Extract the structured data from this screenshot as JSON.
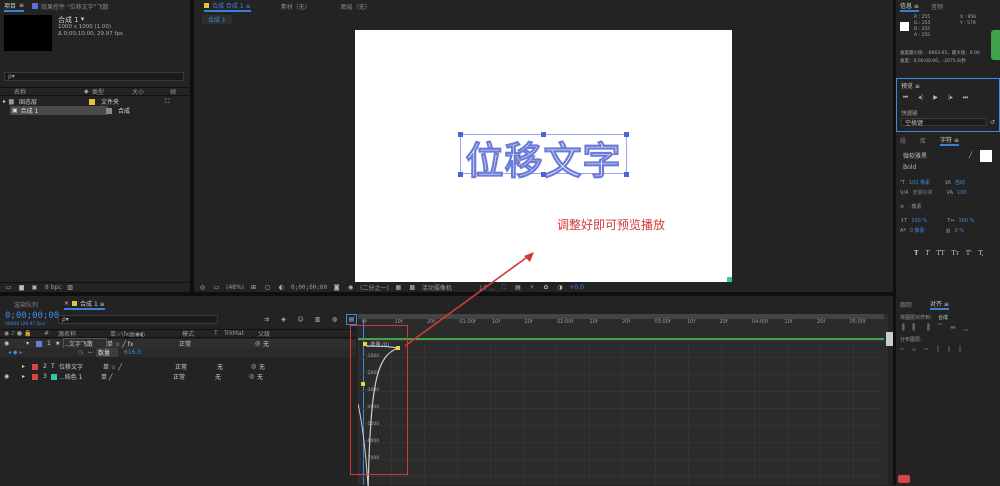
{
  "project": {
    "tabs": [
      "项目",
      "效果控件 \"位移文字\"飞散"
    ],
    "comp_name": "合成 1",
    "comp_arrow": "▾",
    "comp_size": "1000 x 1000 (1.00)",
    "comp_duration": "Δ 0;00;10;00, 29.97 fps",
    "search_placeholder": "ρ▾",
    "columns": {
      "name": "名称",
      "type": "类型",
      "size": "大小",
      "frame": "帧"
    },
    "items": [
      {
        "name": "固态层",
        "type": "文件夹",
        "color": "#e6c13a"
      },
      {
        "name": "合成 1",
        "type": "合成",
        "color": "#8a8a8a"
      }
    ],
    "bpc": "8 bpc"
  },
  "viewer": {
    "tabs": [
      "合成 合成 1 ≡",
      "素材（无）",
      "图层（无）"
    ],
    "subtab": "合成 1",
    "text": "位移文字",
    "annotation": "调整好即可预览播放",
    "zoom": "(48%)",
    "timecode": "0;00;00;00",
    "resolution": "(二分之一)",
    "camera": "活动摄像机",
    "views": "1个...",
    "exposure": "+0.0"
  },
  "timeline": {
    "tabs": [
      "渲染队列",
      "合成 1 ≡"
    ],
    "timecode": "0;00;00;00",
    "fps": "00000 (29.97 fps)",
    "headers": {
      "num": "#",
      "name": "源名称",
      "switches": "单☆\\fx▤◉◐",
      "mode": "模式",
      "t": "T",
      "trkmat": "TrkMat",
      "parent": "父级"
    },
    "layers": [
      {
        "num": "1",
        "color": "#6b7fd6",
        "kind": "★",
        "name": "..文字飞散",
        "mode": "正常",
        "trk": "",
        "parent": "无"
      },
      {
        "num": "2",
        "color": "#d64545",
        "kind": "T",
        "name": "位移文字",
        "mode": "正常",
        "trk": "无",
        "parent": "无"
      },
      {
        "num": "3",
        "color": "#2ec9a8",
        "kind": "",
        "name": "...纯色 1",
        "mode": "正常",
        "trk": "无",
        "parent": "无"
      }
    ],
    "prop_name": "数量",
    "prop_value": "616.0",
    "ruler": [
      "0f",
      "10f",
      "20f",
      "01:00f",
      "10f",
      "20f",
      "02:00f",
      "10f",
      "20f",
      "03:00f",
      "10f",
      "20f",
      "04:00f",
      "10f",
      "20f",
      "05:00f"
    ],
    "graph_label": "9: 数量 (0)",
    "graph_ticks": [
      "-1000",
      "-2000",
      "-3000",
      "-4000",
      "-5000",
      "-6000",
      "-7000"
    ]
  },
  "info": {
    "tabs": [
      "信息 ≡",
      "音频"
    ],
    "rgb": [
      "R : 255",
      "G : 255",
      "B : 255",
      "A : 255"
    ],
    "xy": [
      "X : 956",
      "Y : 579"
    ],
    "line1": "速度最小值：-6663.65，最大值：0.00",
    "line2": "速度：0;00;00;00，-2075.6/秒"
  },
  "preview": {
    "title": "预览 ≡",
    "shortcut_label": "快捷键",
    "shortcut_value": "空格键"
  },
  "character": {
    "tabs": [
      "段",
      "库",
      "字符 ≡"
    ],
    "font": "微软雅黑",
    "style": "Bold",
    "size": "102 像素",
    "auto": "自动",
    "metric": "度量标准",
    "tracking": "100",
    "px": "- 像素",
    "v_scale": "100 %",
    "h_scale": "100 %",
    "baseline": "0 像素",
    "tsume": "0 %",
    "styles": [
      "T",
      "T",
      "TT",
      "Tт",
      "T'",
      "T,"
    ]
  },
  "tracker": {
    "tabs": [
      "跟踪",
      "对齐 ≡"
    ],
    "align_label": "将图层对齐到：",
    "align_value": "合成",
    "distribute": "分布图层："
  }
}
